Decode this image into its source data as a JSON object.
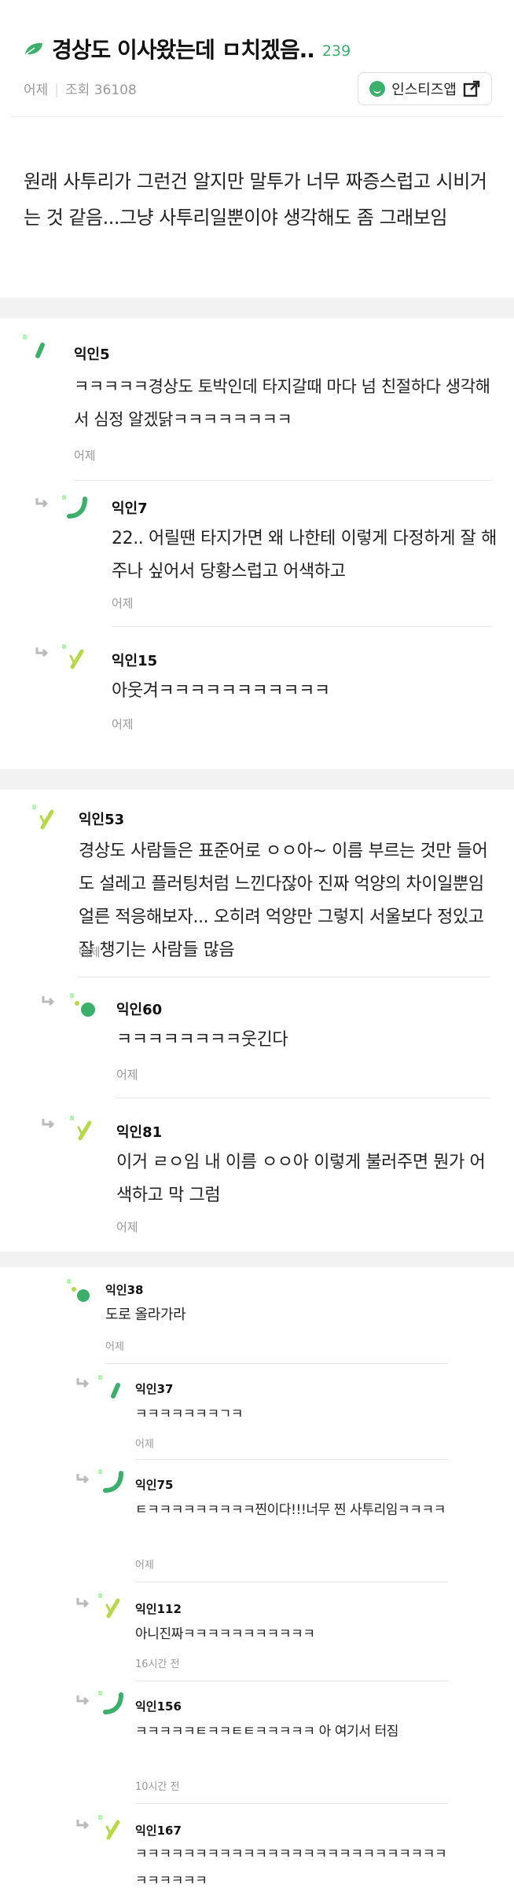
{
  "post": {
    "title": "경상도 이사왔는데 ㅁ치겠음..",
    "comment_count": "239",
    "date": "어제",
    "views": "조회 36108",
    "insta_button": "인스티즈앱",
    "body": "원래 사투리가 그런건 알지만 말투가 너무 짜증스럽고 시비거는 것 같음...그냥 사투리일뿐이야 생각해도 좀 그래보임",
    "colors": {
      "accent": "#3caf6b",
      "bg": "#f2f2f2"
    }
  },
  "comments": [
    {
      "name": "익인5",
      "text": "ㅋㅋㅋㅋㅋ경상도 토박인데 타지갈때 마다 넘 친절하다 생각해서 심정 알겠닭ㅋㅋㅋㅋㅋㅋㅋㅋ",
      "time": "어제",
      "icon": "green-stroke-icon"
    },
    {
      "name": "익인7",
      "text": "22.. 어릴땐 타지가면 왜 나한테 이렇게 다정하게 잘 해주나 싶어서 당황스럽고 어색하고",
      "time": "어제",
      "icon": "green-curve-icon"
    },
    {
      "name": "익인15",
      "text": "아웃겨ㅋㅋㅋㅋㅋㅋㅋㅋㅋㅋㅋ",
      "time": "어제",
      "icon": "green-slash-icon"
    },
    {
      "name": "익인53",
      "text": "경상도 사람들은 표준어로 ㅇㅇ아~ 이름 부르는 것만 들어도 설레고 플러팅처럼 느낀다잖아 진짜 억양의 차이일뿐임 얼른 적응해보자... 오히려 억양만 그렇지 서울보다 정있고 잘 챙기는 사람들 많음",
      "time": "어제",
      "icon": "green-slash-icon"
    },
    {
      "name": "익인60",
      "text": "ㅋㅋㅋㅋㅋㅋㅋㅋ웃긴다",
      "time": "어제",
      "icon": "green-dot-icon"
    },
    {
      "name": "익인81",
      "text": "이거 ㄹㅇ임 내 이름 ㅇㅇ아 이렇게 불러주면 뭔가 어색하고 막 그럼",
      "time": "어제",
      "icon": "green-slash-icon"
    },
    {
      "name": "익인38",
      "text": "도로 올라가라",
      "time": "어제",
      "icon": "green-dot-icon"
    },
    {
      "name": "익인37",
      "text": "ㅋㅋㅋㅋㅋㅋㅋㄱㅋ",
      "time": "어제",
      "icon": "green-stroke-icon"
    },
    {
      "name": "익인75",
      "text": "ㅌㅋㅋㅋㅋㅋㅋㅋㅋㅋ찐이다!!!너무 찐 사투리임ㅋㅋㅋㅋ",
      "time": "어제",
      "icon": "green-curve-icon"
    },
    {
      "name": "익인112",
      "text": "아니진짜ㅋㅋㅋㅋㅋㅋㅋㅋㅋㅋㅋ",
      "time": "16시간 전",
      "icon": "green-slash-icon"
    },
    {
      "name": "익인156",
      "text": "ㅋㅋㅋㅋㅋㅌㅋㅋㅌㅌㅋㅋㅋㅋㅋ 아 여기서 터짐",
      "time": "10시간 전",
      "icon": "green-curve-icon"
    },
    {
      "name": "익인167",
      "text": "ㅋㅋㅋㅋㅋㅋㅋㅋㅋㅋㅋㅋㅋㅋㅋㅋㅋㅋㅋㅋㅋㅋㅋㅋㅋㅋㅋㅋㅋㅋㅋㅋ",
      "time": "",
      "icon": "green-slash-icon"
    }
  ]
}
